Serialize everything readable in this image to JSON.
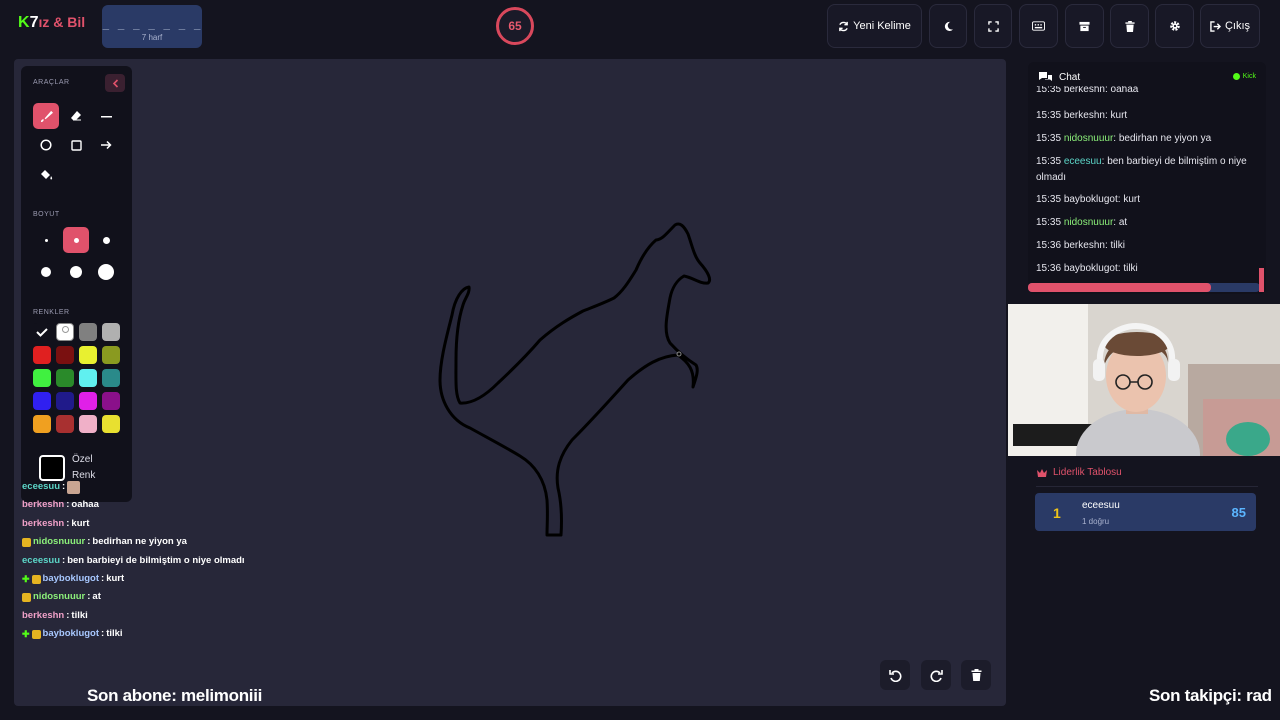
{
  "header": {
    "logo_k": "K",
    "logo_seven": "7",
    "logo_text": "ız & Bil",
    "word_blanks": "_ _ _ _ _ _ _",
    "word_length": "7 harf",
    "timer": "65",
    "new_word_label": "Yeni Kelime",
    "exit_label": "Çıkış"
  },
  "tools": {
    "section_tools": "ARAÇLAR",
    "section_size": "BOYUT",
    "section_colors": "RENKLER",
    "custom_color_line1": "Özel",
    "custom_color_line2": "Renk",
    "palette": [
      "#000000",
      "#ffffff",
      "#808080",
      "#b0b0b0",
      "#e02020",
      "#7a1010",
      "#e8f030",
      "#8a9a20",
      "#40f040",
      "#2a8a2a",
      "#60f0f0",
      "#2a8a8a",
      "#3020f0",
      "#201a8a",
      "#e020e8",
      "#8a108a",
      "#f0a020",
      "#a83030",
      "#f0b0c8",
      "#e8e030"
    ]
  },
  "overlay_chat": [
    {
      "user": "eceesuu",
      "user_color": "#5cd6c8",
      "msg": "",
      "badges": []
    },
    {
      "user": "berkeshn",
      "user_color": "#f0a0c8",
      "msg": "oahaa",
      "badges": []
    },
    {
      "user": "berkeshn",
      "user_color": "#f0a0c8",
      "msg": "kurt",
      "badges": []
    },
    {
      "user": "nidosnuuur",
      "user_color": "#8cf07a",
      "msg": "bedirhan ne yiyon ya",
      "badges": [
        "sub"
      ]
    },
    {
      "user": "eceesuu",
      "user_color": "#5cd6c8",
      "msg": "ben barbieyi de bilmiştim o niye olmadı",
      "badges": []
    },
    {
      "user": "bayboklugot",
      "user_color": "#a8c8ff",
      "msg": "kurt",
      "badges": [
        "mod",
        "sub"
      ]
    },
    {
      "user": "nidosnuuur",
      "user_color": "#8cf07a",
      "msg": "at",
      "badges": [
        "sub"
      ]
    },
    {
      "user": "berkeshn",
      "user_color": "#f0a0c8",
      "msg": "tilki",
      "badges": []
    },
    {
      "user": "bayboklugot",
      "user_color": "#a8c8ff",
      "msg": "tilki",
      "badges": [
        "mod",
        "sub"
      ]
    }
  ],
  "chat": {
    "title": "Chat",
    "platform": "Kick",
    "messages": [
      {
        "time": "15:35",
        "user": "berkeshn",
        "user_color": "#e6e6ee",
        "msg": "oahaa"
      },
      {
        "time": "15:35",
        "user": "berkeshn",
        "user_color": "#e6e6ee",
        "msg": "kurt"
      },
      {
        "time": "15:35",
        "user": "nidosnuuur",
        "user_color": "#8cf07a",
        "msg": "bedirhan ne yiyon ya"
      },
      {
        "time": "15:35",
        "user": "eceesuu",
        "user_color": "#5cd6c8",
        "msg": "ben barbieyi de bilmiştim o niye olmadı"
      },
      {
        "time": "15:35",
        "user": "bayboklugot",
        "user_color": "#e6e6ee",
        "msg": "kurt"
      },
      {
        "time": "15:35",
        "user": "nidosnuuur",
        "user_color": "#8cf07a",
        "msg": "at"
      },
      {
        "time": "15:36",
        "user": "berkeshn",
        "user_color": "#e6e6ee",
        "msg": "tilki"
      },
      {
        "time": "15:36",
        "user": "bayboklugot",
        "user_color": "#e6e6ee",
        "msg": "tilki"
      }
    ],
    "progress_fraction": 0.79
  },
  "leaderboard": {
    "title": "Liderlik Tablosu",
    "entries": [
      {
        "rank": "1",
        "name": "eceesuu",
        "sub": "1 doğru",
        "score": "85"
      }
    ]
  },
  "ticker": {
    "left": "Son abone: melimoniii",
    "right": "Son takipçi: rad"
  },
  "colors": {
    "accent": "#e0526b",
    "kick_green": "#53fc18",
    "panel_blue": "#2a3a66"
  }
}
